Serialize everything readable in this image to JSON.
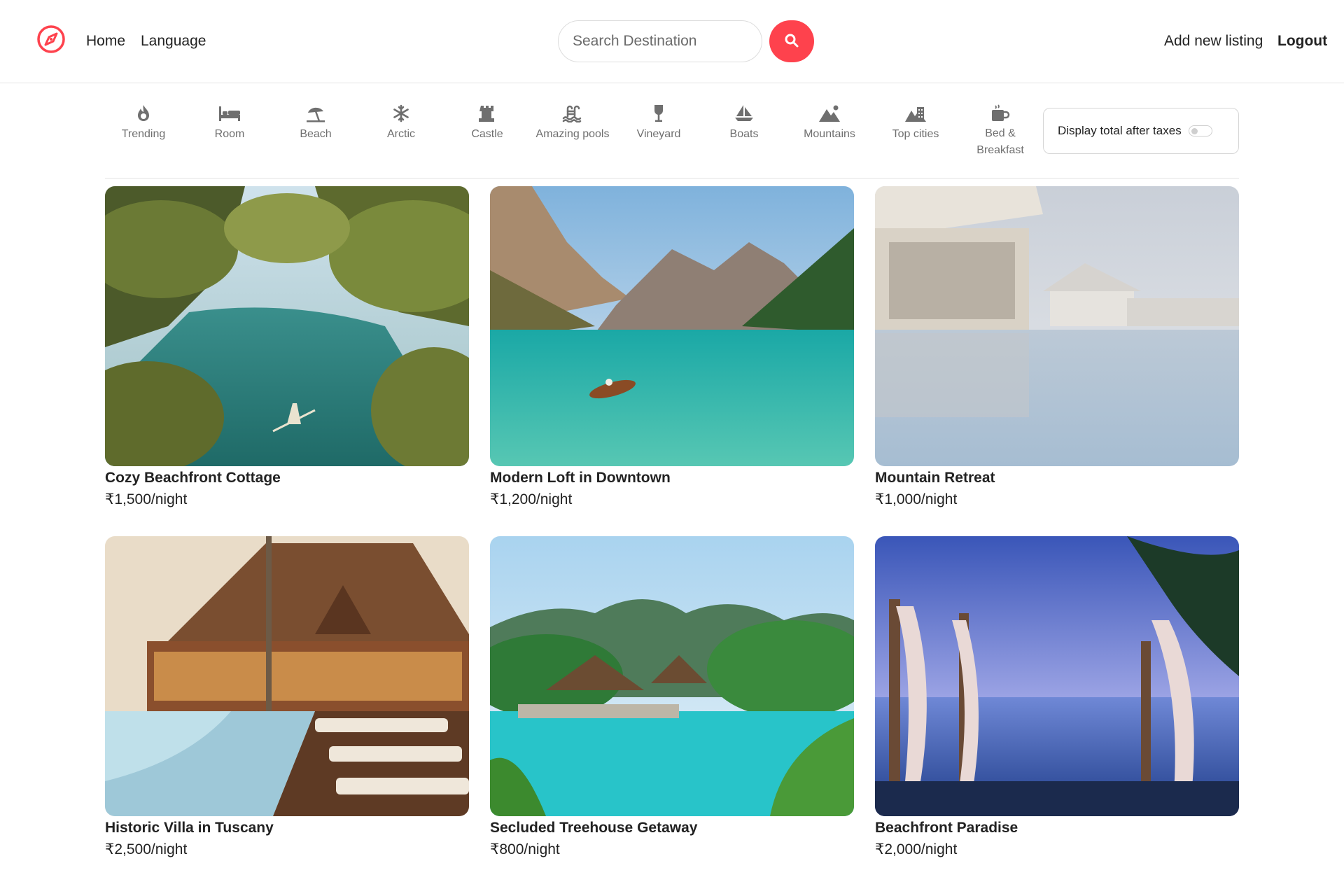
{
  "nav": {
    "logo_icon": "compass-icon",
    "home": "Home",
    "language": "Language",
    "search_placeholder": "Search Destination",
    "search_icon": "search-icon",
    "add_listing": "Add new listing",
    "logout": "Logout",
    "accent": "#fe424d"
  },
  "filters": [
    {
      "label": "Trending",
      "icon": "fire-icon"
    },
    {
      "label": "Room",
      "icon": "bed-icon"
    },
    {
      "label": "Beach",
      "icon": "umbrella-icon"
    },
    {
      "label": "Arctic",
      "icon": "snowflake-icon"
    },
    {
      "label": "Castle",
      "icon": "castle-icon"
    },
    {
      "label": "Amazing pools",
      "icon": "pool-icon"
    },
    {
      "label": "Vineyard",
      "icon": "wine-glass-icon"
    },
    {
      "label": "Boats",
      "icon": "sailboat-icon"
    },
    {
      "label": "Mountains",
      "icon": "mountain-icon"
    },
    {
      "label": "Top cities",
      "icon": "city-icon"
    },
    {
      "label": "Bed & Breakfast",
      "icon": "mug-icon"
    }
  ],
  "tax_toggle": {
    "label": "Display total after taxes",
    "enabled": false
  },
  "listings": [
    {
      "title": "Cozy Beachfront Cottage",
      "price": "₹1,500/night"
    },
    {
      "title": "Modern Loft in Downtown",
      "price": "₹1,200/night"
    },
    {
      "title": "Mountain Retreat",
      "price": "₹1,000/night"
    },
    {
      "title": "Historic Villa in Tuscany",
      "price": "₹2,500/night"
    },
    {
      "title": "Secluded Treehouse Getaway",
      "price": "₹800/night"
    },
    {
      "title": "Beachfront Paradise",
      "price": "₹2,000/night"
    }
  ]
}
